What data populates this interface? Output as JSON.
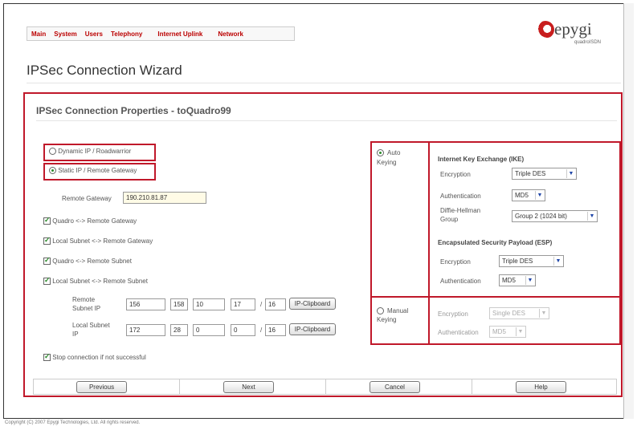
{
  "nav": {
    "items": [
      "Main",
      "System",
      "Users",
      "Telephony",
      "Internet Uplink",
      "Network"
    ]
  },
  "logo": {
    "word": "epygi",
    "sub": "quadroISDN"
  },
  "page": {
    "title": "IPSec Connection Wizard",
    "subtitle": "IPSec Connection Properties - toQuadro99"
  },
  "ip_mode": {
    "dynamic_label": "Dynamic IP / Roadwarrior",
    "dynamic_selected": false,
    "static_label": "Static IP / Remote Gateway",
    "static_selected": true
  },
  "remote_gateway": {
    "label": "Remote Gateway",
    "value": "190.210.81.87"
  },
  "options": [
    {
      "label": "Quadro <-> Remote Gateway",
      "checked": true
    },
    {
      "label": "Local Subnet <-> Remote Gateway",
      "checked": true
    },
    {
      "label": "Quadro <-> Remote Subnet",
      "checked": true
    },
    {
      "label": "Local Subnet <-> Remote Subnet",
      "checked": true
    }
  ],
  "remote_subnet": {
    "label": "Remote Subnet IP",
    "octets": [
      "156",
      "158",
      "10",
      "17"
    ],
    "mask": "16",
    "button": "IP-Clipboard"
  },
  "local_subnet": {
    "label": "Local Subnet IP",
    "octets": [
      "172",
      "28",
      "0",
      "0"
    ],
    "mask": "16",
    "button": "IP-Clipboard"
  },
  "stop_option": {
    "label": "Stop connection if not successful",
    "checked": true
  },
  "auto_keying": {
    "label": "Auto Keying",
    "selected": true,
    "ike_header": "Internet Key Exchange (IKE)",
    "ike_encryption_label": "Encryption",
    "ike_encryption": "Triple DES",
    "ike_auth_label": "Authentication",
    "ike_auth": "MD5",
    "dh_label": "Diffie-Hellman Group",
    "dh_group": "Group 2 (1024 bit)",
    "esp_header": "Encapsulated Security Payload (ESP)",
    "esp_encryption_label": "Encryption",
    "esp_encryption": "Triple DES",
    "esp_auth_label": "Authentication",
    "esp_auth": "MD5"
  },
  "manual_keying": {
    "label": "Manual Keying",
    "selected": false,
    "encryption_label": "Encryption",
    "encryption": "Single DES",
    "auth_label": "Authentication",
    "auth": "MD5"
  },
  "buttons": {
    "previous": "Previous",
    "next": "Next",
    "cancel": "Cancel",
    "help": "Help"
  },
  "footer": {
    "copyright": "Copyright (C) 2007 Epygi Technologies, Ltd. All rights reserved."
  },
  "colors": {
    "accent_red": "#c0182a",
    "nav_red": "#b00000",
    "radio_green": "#2a8a2a"
  }
}
